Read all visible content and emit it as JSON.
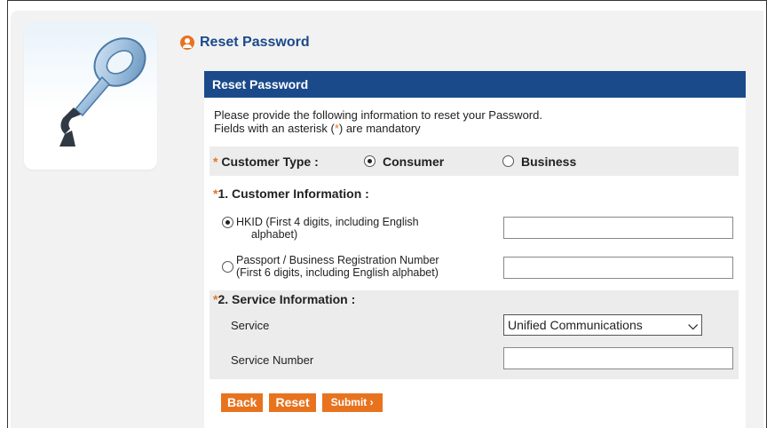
{
  "heading": {
    "title": "Reset Password"
  },
  "form": {
    "header": "Reset Password",
    "intro_line1": "Please provide the following information to reset your Password.",
    "intro_line2_pre": "Fields with an asterisk (",
    "intro_line2_star": "*",
    "intro_line2_post": ") are mandatory",
    "customer_type": {
      "label": "Customer Type :",
      "options": [
        {
          "label": "Consumer",
          "selected": true
        },
        {
          "label": "Business",
          "selected": false
        }
      ]
    },
    "section1": {
      "title": "1. Customer Information :",
      "hkid_line1": "HKID (First 4 digits, including English",
      "hkid_line2": "alphabet)",
      "hkid_selected": true,
      "hkid_value": "",
      "passport_line1": "Passport / Business Registration Number",
      "passport_line2": "(First 6 digits, including English alphabet)",
      "passport_selected": false,
      "passport_value": ""
    },
    "section2": {
      "title": "2. Service Information :",
      "service_label": "Service",
      "service_value": "Unified Communications",
      "service_number_label": "Service Number",
      "service_number_value": ""
    },
    "buttons": {
      "back": "Back",
      "reset": "Reset",
      "submit": "Submit ›"
    }
  },
  "colors": {
    "header_bg": "#1a4a8a",
    "accent": "#e8731f"
  }
}
